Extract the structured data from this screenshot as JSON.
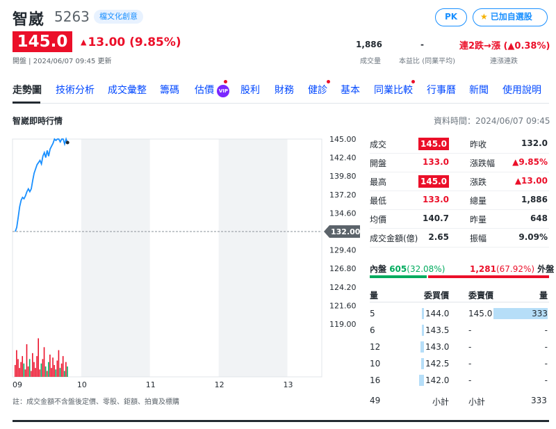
{
  "header": {
    "name": "智崴",
    "code": "5263",
    "tag": "檔文化創意",
    "pk_label": "PK",
    "watchlist_label": "已加自選股",
    "price": "145.0",
    "change": "13.00 (9.85%)",
    "open_time": "開盤 | 2024/06/07 09:45 更新",
    "volume_value": "1,886",
    "volume_label": "成交量",
    "pe_value": "-",
    "pe_label": "本益比 (同業平均)",
    "streak_value": "連2跌→漲 (▲0.38%)",
    "streak_label": "連漲連跌"
  },
  "tabs": [
    {
      "label": "走勢圖"
    },
    {
      "label": "技術分析"
    },
    {
      "label": "成交彙整"
    },
    {
      "label": "籌碼"
    },
    {
      "label": "估價"
    },
    {
      "label": "股利"
    },
    {
      "label": "財務"
    },
    {
      "label": "健診"
    },
    {
      "label": "基本"
    },
    {
      "label": "同業比較"
    },
    {
      "label": "行事曆"
    },
    {
      "label": "新聞"
    },
    {
      "label": "使用說明"
    }
  ],
  "vip_label": "VIP",
  "section": {
    "title": "智崴即時行情",
    "data_time": "資料時間：2024/06/07 09:45"
  },
  "chart_data": {
    "type": "line",
    "y_ticks": [
      "145.00",
      "142.40",
      "139.80",
      "137.20",
      "134.60",
      "132.00",
      "129.40",
      "126.80",
      "124.20",
      "121.60",
      "119.00"
    ],
    "ylim": [
      119,
      145
    ],
    "ref_price": 132.0,
    "ref_label": "132.00",
    "x_ticks": [
      "09",
      "10",
      "11",
      "12",
      "13"
    ],
    "price_series": [
      132.0,
      132.6,
      134.0,
      135.5,
      136.4,
      136.8,
      136.6,
      137.0,
      137.6,
      138.0,
      137.6,
      138.0,
      139.2,
      140.2,
      140.8,
      141.4,
      141.7,
      142.0,
      141.5,
      142.6,
      143.1,
      142.4,
      143.4,
      142.6,
      143.6,
      144.0,
      144.4,
      145.0,
      144.8,
      145.0,
      145.0,
      144.6,
      145.0,
      145.0,
      144.3,
      145.0,
      144.4
    ],
    "volume_series": [
      8,
      18,
      12,
      6,
      10,
      14,
      9,
      5,
      22,
      7,
      12,
      4,
      16,
      10,
      6,
      14,
      26,
      5,
      9,
      12,
      20,
      7,
      4,
      10,
      15,
      6,
      13,
      8,
      5,
      11,
      18,
      6,
      9,
      14,
      4,
      10,
      7
    ],
    "vol_max": 30,
    "footnote": "註：成交金額不含盤後定價、零股、鉅額、拍賣及標購"
  },
  "quote": {
    "rows": [
      {
        "l1": "成交",
        "v1": "145.0",
        "l2": "昨收",
        "v2": "132.0"
      },
      {
        "l1": "開盤",
        "v1": "133.0",
        "l2": "漲跌幅",
        "v2": "▲9.85%"
      },
      {
        "l1": "最高",
        "v1": "145.0",
        "l2": "漲跌",
        "v2": "▲13.00"
      },
      {
        "l1": "最低",
        "v1": "133.0",
        "l2": "總量",
        "v2": "1,886"
      },
      {
        "l1": "均價",
        "v1": "140.7",
        "l2": "昨量",
        "v2": "648"
      },
      {
        "l1": "成交金額(億)",
        "v1": "2.65",
        "l2": "振幅",
        "v2": "9.09%"
      }
    ],
    "inner_label": "內盤",
    "inner_value": "605",
    "inner_pct": "(32.08%)",
    "outer_value": "1,281",
    "outer_pct": "(67.92%)",
    "outer_label": "外盤",
    "inner_fraction": 0.3208
  },
  "orderbook": {
    "h_qty_buy": "量",
    "h_bid": "委買價",
    "h_ask": "委賣價",
    "h_qty_sell": "量",
    "rows": [
      {
        "bq": "5",
        "bp": "144.0",
        "ap": "145.0",
        "aq": "333"
      },
      {
        "bq": "6",
        "bp": "143.5",
        "ap": "-",
        "aq": "-"
      },
      {
        "bq": "12",
        "bp": "143.0",
        "ap": "-",
        "aq": "-"
      },
      {
        "bq": "10",
        "bp": "142.5",
        "ap": "-",
        "aq": "-"
      },
      {
        "bq": "16",
        "bp": "142.0",
        "ap": "-",
        "aq": "-"
      }
    ],
    "buy_fractions": [
      0.02,
      0.02,
      0.04,
      0.03,
      0.05
    ],
    "sell_fractions": [
      1.0,
      0,
      0,
      0,
      0
    ],
    "total_buy": "49",
    "subtotal_label": "小計",
    "subtotal_label2": "小計",
    "total_sell": "333"
  }
}
